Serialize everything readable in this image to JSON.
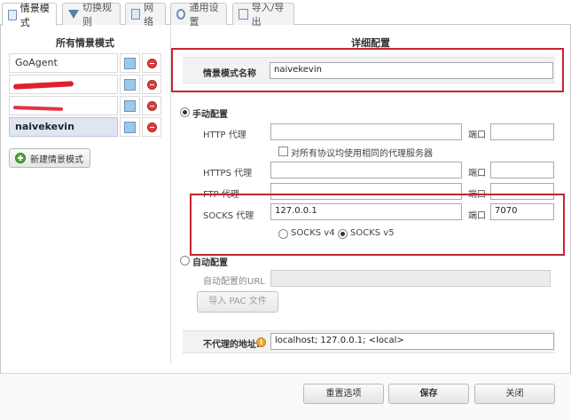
{
  "tabs": [
    {
      "label": "情景模式",
      "icon": "document-icon"
    },
    {
      "label": "切换规则",
      "icon": "filter-icon"
    },
    {
      "label": "网络",
      "icon": "network-icon"
    },
    {
      "label": "通用设置",
      "icon": "gear-icon"
    },
    {
      "label": "导入/导出",
      "icon": "import-export-icon"
    }
  ],
  "left": {
    "title": "所有情景模式",
    "profiles": [
      {
        "name": "GoAgent",
        "color": "#9cc8ea"
      },
      {
        "name": "",
        "color": "#9cc8ea"
      },
      {
        "name": "",
        "color": "#9cc8ea"
      },
      {
        "name": "naivekevin",
        "color": "#9cc8ea"
      }
    ],
    "new_button": "新建情景模式"
  },
  "right": {
    "title": "详细配置",
    "profile_name_label": "情景模式名称",
    "profile_name_value": "naivekevin",
    "manual_label": "手动配置",
    "http_label": "HTTP 代理",
    "http_value": "",
    "port_label": "端口",
    "http_port": "",
    "same_proxy_label": "对所有协议均使用相同的代理服务器",
    "https_label": "HTTPS 代理",
    "https_value": "",
    "https_port": "",
    "ftp_label": "FTP 代理",
    "ftp_value": "",
    "ftp_port": "",
    "socks_label": "SOCKS 代理",
    "socks_value": "127.0.0.1",
    "socks_port": "7070",
    "socks_v4": "SOCKS v4",
    "socks_v5": "SOCKS v5",
    "auto_label": "自动配置",
    "auto_url_label": "自动配置的URL",
    "auto_url_value": "",
    "pac_button": "导入 PAC 文件",
    "bypass_label": "不代理的地址:",
    "bypass_value": "localhost; 127.0.0.1; <local>"
  },
  "footer": {
    "reset": "重置选项",
    "save": "保存",
    "close": "关闭"
  },
  "colors": {
    "highlight_border": "#c3262e",
    "delete_icon": "#d9413a",
    "profile_color": "#9cc8ea"
  }
}
